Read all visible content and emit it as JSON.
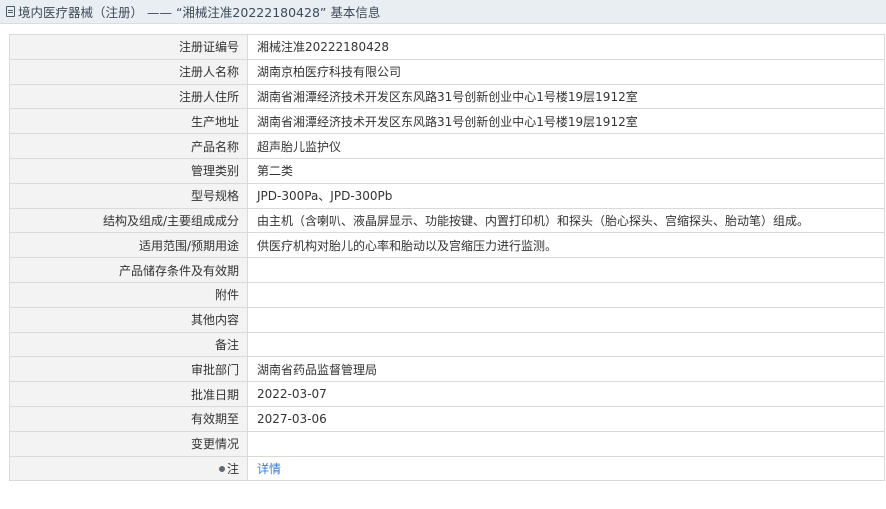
{
  "header": {
    "title": "境内医疗器械（注册） —— “湘械注准20222180428” 基本信息",
    "icon": "document-icon"
  },
  "rows": [
    {
      "label": "注册证编号",
      "value": "湘械注准20222180428"
    },
    {
      "label": "注册人名称",
      "value": "湖南京柏医疗科技有限公司"
    },
    {
      "label": "注册人住所",
      "value": "湖南省湘潭经济技术开发区东风路31号创新创业中心1号楼19层1912室"
    },
    {
      "label": "生产地址",
      "value": "湖南省湘潭经济技术开发区东风路31号创新创业中心1号楼19层1912室"
    },
    {
      "label": "产品名称",
      "value": "超声胎儿监护仪"
    },
    {
      "label": "管理类别",
      "value": "第二类"
    },
    {
      "label": "型号规格",
      "value": "JPD-300Pa、JPD-300Pb"
    },
    {
      "label": "结构及组成/主要组成成分",
      "value": "由主机（含喇叭、液晶屏显示、功能按键、内置打印机）和探头（胎心探头、宫缩探头、胎动笔）组成。"
    },
    {
      "label": "适用范围/预期用途",
      "value": "供医疗机构对胎儿的心率和胎动以及宫缩压力进行监测。"
    },
    {
      "label": "产品储存条件及有效期",
      "value": ""
    },
    {
      "label": "附件",
      "value": ""
    },
    {
      "label": "其他内容",
      "value": ""
    },
    {
      "label": "备注",
      "value": ""
    },
    {
      "label": "审批部门",
      "value": "湖南省药品监督管理局"
    },
    {
      "label": "批准日期",
      "value": "2022-03-07"
    },
    {
      "label": "有效期至",
      "value": "2027-03-06"
    },
    {
      "label": "变更情况",
      "value": ""
    }
  ],
  "note": {
    "label": "注",
    "link": "详情",
    "icon": "pin-icon"
  },
  "colors": {
    "header_bg": "#e9eef3",
    "label_bg": "#f3f3f3",
    "border": "#d9d9d9",
    "link": "#3a7bd5"
  }
}
